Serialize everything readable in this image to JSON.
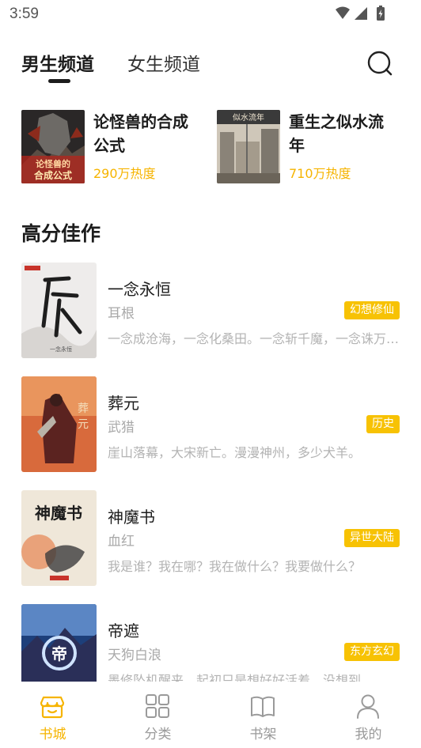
{
  "status_bar": {
    "time": "3:59"
  },
  "tabs": {
    "male": "男生频道",
    "female": "女生频道",
    "active": "male"
  },
  "featured": [
    {
      "title": "论怪兽的合成公式",
      "heat": "290万热度",
      "cover_text": "论怪兽的合成公式"
    },
    {
      "title": "重生之似水流年",
      "heat": "710万热度",
      "cover_text": "似水流年"
    }
  ],
  "section": {
    "title": "高分佳作"
  },
  "books": [
    {
      "title": "一念永恒",
      "author": "耳根",
      "tag": "幻想修仙",
      "desc": "一念成沧海，一念化桑田。一念斩千魔，一念诛万仙。",
      "cover_text": "一念永恒"
    },
    {
      "title": "葬元",
      "author": "武猎",
      "tag": "历史",
      "desc": "崖山落幕，大宋新亡。漫漫神州，多少犬羊。",
      "cover_text": "葬元"
    },
    {
      "title": "神魔书",
      "author": "血红",
      "tag": "异世大陆",
      "desc": "我是谁？我在哪？我在做什么？我要做什么？",
      "cover_text": "神魔书"
    },
    {
      "title": "帝遮",
      "author": "天狗白浪",
      "tag": "东方玄幻",
      "desc": "墨修坠机醒来，起初只是想好好活着，没想到",
      "cover_text": "帝遮"
    }
  ],
  "nav": [
    {
      "label": "书城",
      "icon": "bookstore-icon",
      "active": true
    },
    {
      "label": "分类",
      "icon": "category-grid-icon",
      "active": false
    },
    {
      "label": "书架",
      "icon": "bookshelf-book-icon",
      "active": false
    },
    {
      "label": "我的",
      "icon": "profile-person-icon",
      "active": false
    }
  ],
  "colors": {
    "accent": "#f6b400",
    "tag_bg": "#f7c204",
    "text_dark": "#1c1c1c",
    "text_muted": "#a9a9a9"
  }
}
